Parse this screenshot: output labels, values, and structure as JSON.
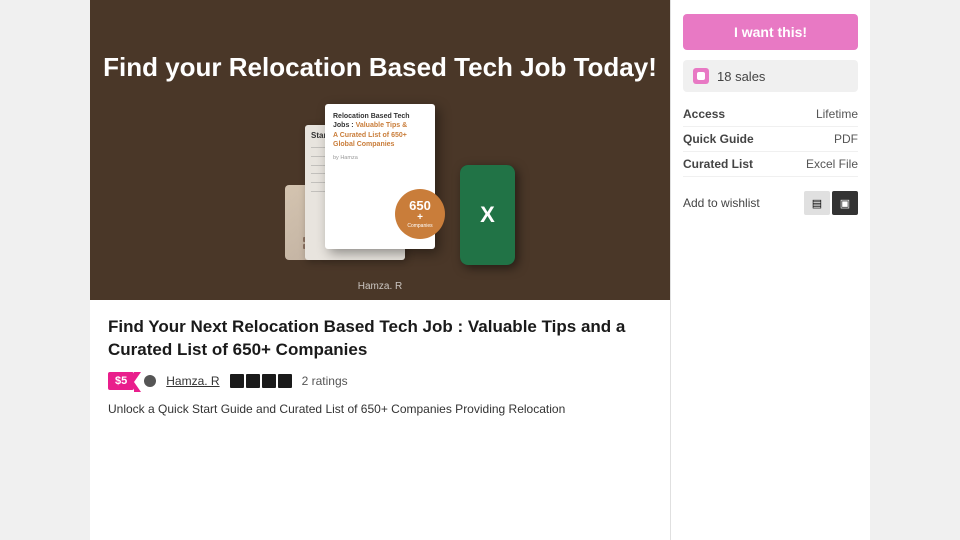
{
  "hero": {
    "title": "Find your Relocation Based\nTech Job Today!",
    "author": "Hamza. R",
    "book": {
      "title": "Relocation Based Tech Jobs : Valuable Tips &\nA Curated List of 650+\nGlobal Companies",
      "badge_num": "650+",
      "badge_text": "Companies"
    },
    "started_label": "Started:"
  },
  "product": {
    "title": "Find Your Next Relocation Based Tech Job : Valuable Tips and a Curated List of 650+ Companies",
    "price": "$5",
    "author": "Hamza. R",
    "ratings_count": "2 ratings",
    "description": "Unlock a Quick Start Guide and Curated List of 650+ Companies Providing Relocation"
  },
  "sidebar": {
    "want_btn": "I want this!",
    "sales_text": "18 sales",
    "access_label": "Access",
    "access_value": "Lifetime",
    "quick_guide_label": "Quick Guide",
    "quick_guide_value": "PDF",
    "curated_list_label": "Curated List",
    "curated_list_value": "Excel File",
    "wishlist_label": "Add to wishlist"
  }
}
